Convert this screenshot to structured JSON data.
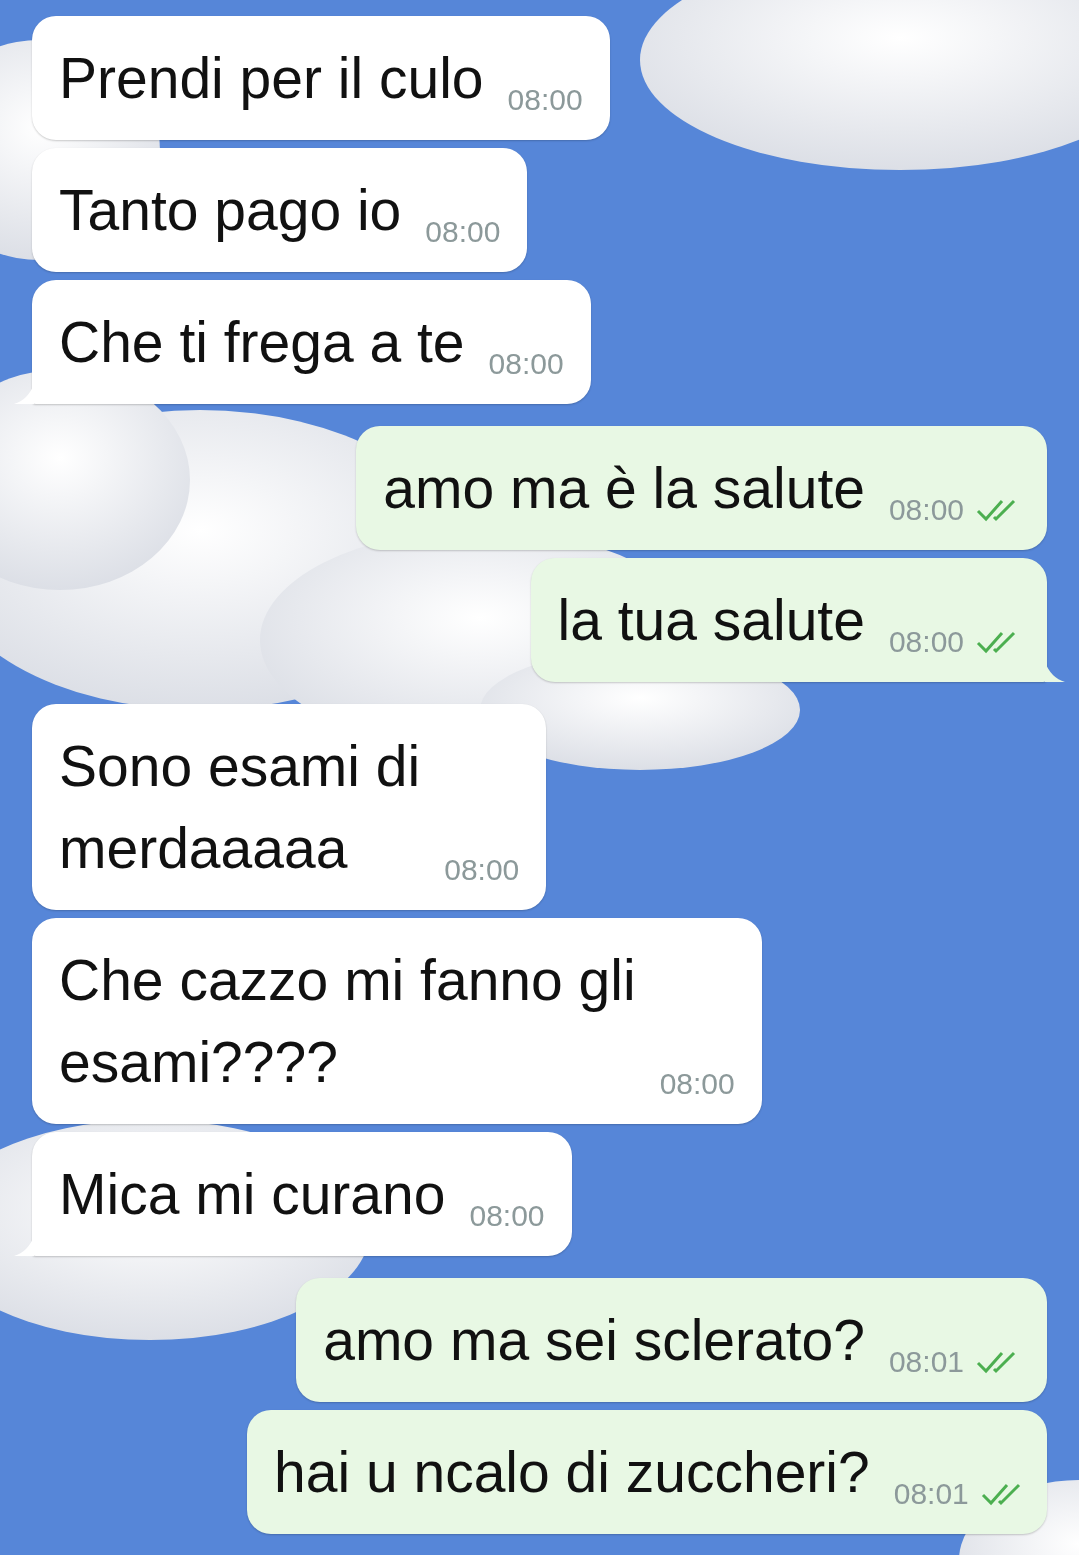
{
  "messages": [
    {
      "kind": "received",
      "text": "Prendi per il culo",
      "time": "08:00",
      "tail": false
    },
    {
      "kind": "received",
      "text": "Tanto pago io",
      "time": "08:00",
      "tail": false
    },
    {
      "kind": "received",
      "text": "Che ti frega a te",
      "time": "08:00",
      "tail": true
    },
    {
      "kind": "sent",
      "text": "amo ma è la salute",
      "time": "08:00",
      "tail": false,
      "read": true
    },
    {
      "kind": "sent",
      "text": "la tua salute",
      "time": "08:00",
      "tail": true,
      "read": true
    },
    {
      "kind": "received",
      "text": "Sono esami di\nmerdaaaaa",
      "time": "08:00",
      "tail": false
    },
    {
      "kind": "received",
      "text": "Che cazzo mi fanno gli\nesami????",
      "time": "08:00",
      "tail": false
    },
    {
      "kind": "received",
      "text": "Mica mi curano",
      "time": "08:00",
      "tail": true
    },
    {
      "kind": "sent",
      "text": "amo ma sei sclerato?",
      "time": "08:01",
      "tail": false,
      "read": true
    },
    {
      "kind": "sent",
      "text": "hai u ncalo di zuccheri?",
      "time": "08:01",
      "tail": false,
      "read": true
    }
  ]
}
